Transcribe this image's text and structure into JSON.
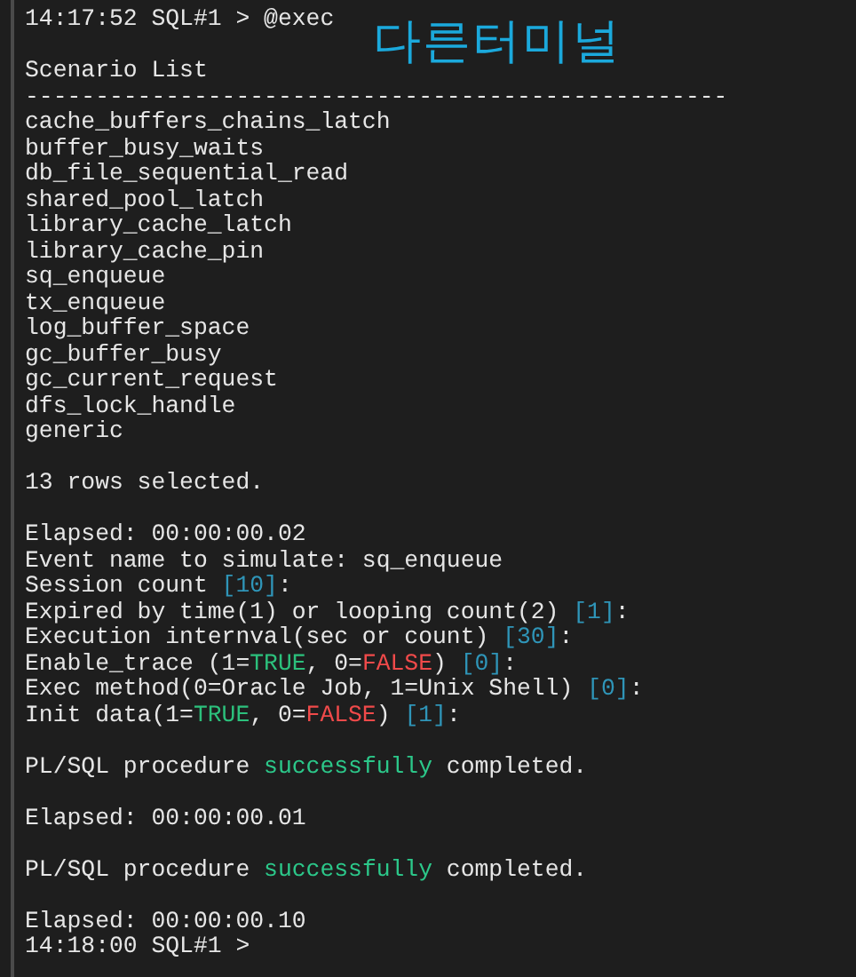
{
  "annotation": "다른터미널",
  "lines": [
    {
      "kind": "text",
      "segments": [
        {
          "kind": "plain",
          "text": "14:17:52 SQL#1 > @exec"
        }
      ]
    },
    {
      "kind": "blank"
    },
    {
      "kind": "text",
      "segments": [
        {
          "kind": "plain",
          "text": "Scenario List"
        }
      ]
    },
    {
      "kind": "text",
      "segments": [
        {
          "kind": "plain",
          "text": "--------------------------------------------------"
        }
      ]
    },
    {
      "kind": "text",
      "segments": [
        {
          "kind": "plain",
          "text": "cache_buffers_chains_latch"
        }
      ]
    },
    {
      "kind": "text",
      "segments": [
        {
          "kind": "plain",
          "text": "buffer_busy_waits"
        }
      ]
    },
    {
      "kind": "text",
      "segments": [
        {
          "kind": "plain",
          "text": "db_file_sequential_read"
        }
      ]
    },
    {
      "kind": "text",
      "segments": [
        {
          "kind": "plain",
          "text": "shared_pool_latch"
        }
      ]
    },
    {
      "kind": "text",
      "segments": [
        {
          "kind": "plain",
          "text": "library_cache_latch"
        }
      ]
    },
    {
      "kind": "text",
      "segments": [
        {
          "kind": "plain",
          "text": "library_cache_pin"
        }
      ]
    },
    {
      "kind": "text",
      "segments": [
        {
          "kind": "plain",
          "text": "sq_enqueue"
        }
      ]
    },
    {
      "kind": "text",
      "segments": [
        {
          "kind": "plain",
          "text": "tx_enqueue"
        }
      ]
    },
    {
      "kind": "text",
      "segments": [
        {
          "kind": "plain",
          "text": "log_buffer_space"
        }
      ]
    },
    {
      "kind": "text",
      "segments": [
        {
          "kind": "plain",
          "text": "gc_buffer_busy"
        }
      ]
    },
    {
      "kind": "text",
      "segments": [
        {
          "kind": "plain",
          "text": "gc_current_request"
        }
      ]
    },
    {
      "kind": "text",
      "segments": [
        {
          "kind": "plain",
          "text": "dfs_lock_handle"
        }
      ]
    },
    {
      "kind": "text",
      "segments": [
        {
          "kind": "plain",
          "text": "generic"
        }
      ]
    },
    {
      "kind": "blank"
    },
    {
      "kind": "text",
      "segments": [
        {
          "kind": "plain",
          "text": "13 rows selected."
        }
      ]
    },
    {
      "kind": "blank"
    },
    {
      "kind": "text",
      "segments": [
        {
          "kind": "plain",
          "text": "Elapsed: 00:00:00.02"
        }
      ]
    },
    {
      "kind": "text",
      "segments": [
        {
          "kind": "plain",
          "text": "Event name to simulate: sq_enqueue"
        }
      ]
    },
    {
      "kind": "text",
      "segments": [
        {
          "kind": "plain",
          "text": "Session count "
        },
        {
          "kind": "value",
          "text": "[10]"
        },
        {
          "kind": "plain",
          "text": ":"
        }
      ]
    },
    {
      "kind": "text",
      "segments": [
        {
          "kind": "plain",
          "text": "Expired by time(1) or looping count(2) "
        },
        {
          "kind": "value",
          "text": "[1]"
        },
        {
          "kind": "plain",
          "text": ":"
        }
      ]
    },
    {
      "kind": "text",
      "segments": [
        {
          "kind": "plain",
          "text": "Execution internval(sec or count) "
        },
        {
          "kind": "value",
          "text": "[30]"
        },
        {
          "kind": "plain",
          "text": ":"
        }
      ]
    },
    {
      "kind": "text",
      "segments": [
        {
          "kind": "plain",
          "text": "Enable_trace (1="
        },
        {
          "kind": "true",
          "text": "TRUE"
        },
        {
          "kind": "plain",
          "text": ", 0="
        },
        {
          "kind": "false",
          "text": "FALSE"
        },
        {
          "kind": "plain",
          "text": ") "
        },
        {
          "kind": "value",
          "text": "[0]"
        },
        {
          "kind": "plain",
          "text": ":"
        }
      ]
    },
    {
      "kind": "text",
      "segments": [
        {
          "kind": "plain",
          "text": "Exec method(0=Oracle Job, 1=Unix Shell) "
        },
        {
          "kind": "value",
          "text": "[0]"
        },
        {
          "kind": "plain",
          "text": ":"
        }
      ]
    },
    {
      "kind": "text",
      "segments": [
        {
          "kind": "plain",
          "text": "Init data(1="
        },
        {
          "kind": "true",
          "text": "TRUE"
        },
        {
          "kind": "plain",
          "text": ", 0="
        },
        {
          "kind": "false",
          "text": "FALSE"
        },
        {
          "kind": "plain",
          "text": ") "
        },
        {
          "kind": "value",
          "text": "[1]"
        },
        {
          "kind": "plain",
          "text": ":"
        }
      ]
    },
    {
      "kind": "blank"
    },
    {
      "kind": "text",
      "segments": [
        {
          "kind": "plain",
          "text": "PL/SQL procedure "
        },
        {
          "kind": "success",
          "text": "successfully"
        },
        {
          "kind": "plain",
          "text": " completed."
        }
      ]
    },
    {
      "kind": "blank"
    },
    {
      "kind": "text",
      "segments": [
        {
          "kind": "plain",
          "text": "Elapsed: 00:00:00.01"
        }
      ]
    },
    {
      "kind": "blank"
    },
    {
      "kind": "text",
      "segments": [
        {
          "kind": "plain",
          "text": "PL/SQL procedure "
        },
        {
          "kind": "success",
          "text": "successfully"
        },
        {
          "kind": "plain",
          "text": " completed."
        }
      ]
    },
    {
      "kind": "blank"
    },
    {
      "kind": "text",
      "segments": [
        {
          "kind": "plain",
          "text": "Elapsed: 00:00:00.10"
        }
      ]
    },
    {
      "kind": "text",
      "segments": [
        {
          "kind": "plain",
          "text": "14:18:00 SQL#1 >"
        }
      ]
    }
  ]
}
